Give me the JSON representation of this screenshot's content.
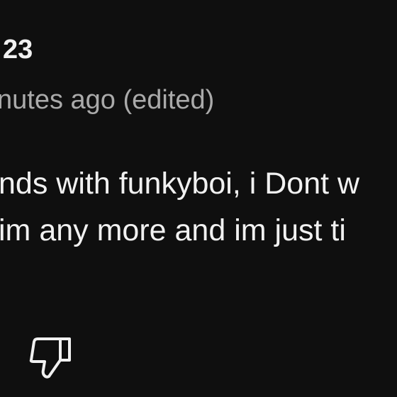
{
  "comment": {
    "author_fragment": "23",
    "time_fragment": "nutes ago",
    "edited_label": "(edited)",
    "text_lines": [
      "nds with funkyboi, i Dont w",
      "im any more and im just ti"
    ]
  },
  "actions": {
    "dislike_icon": "thumbs-down-outline-icon"
  }
}
